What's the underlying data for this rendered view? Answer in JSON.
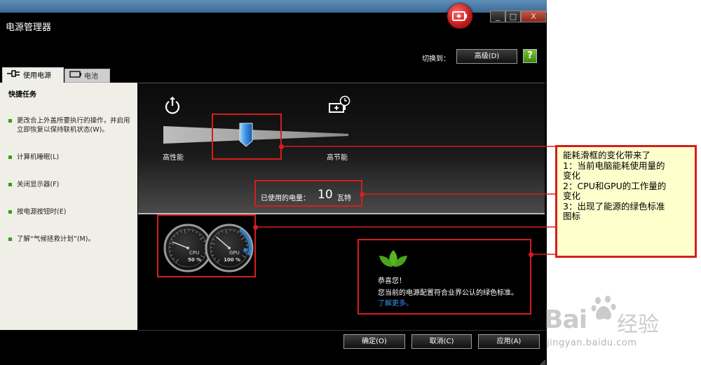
{
  "window": {
    "title": "电源管理器"
  },
  "title_controls": {
    "minimize": "_",
    "maximize": "□",
    "close": "X"
  },
  "header": {
    "switch_label": "切换到：",
    "advanced_button": "高级(D)",
    "help_glyph": "?"
  },
  "tabs": [
    {
      "label": "使用电源"
    },
    {
      "label": "电池"
    }
  ],
  "left_panel": {
    "title": "快捷任务",
    "items": [
      {
        "label": "更改合上外盖所要执行的操作，并启用立即恢复以保持联机状态(W)。"
      },
      {
        "label": "计算机睡眠(L)"
      },
      {
        "label": "关闭显示器(F)"
      },
      {
        "label": "按电源按钮时(E)"
      },
      {
        "label": "了解“气候拯救计划”(M)。"
      }
    ]
  },
  "slider": {
    "left_label": "高性能",
    "right_label": "高节能"
  },
  "power": {
    "label": "已使用的电量：",
    "value": "10",
    "unit": "瓦特"
  },
  "gauges": {
    "cpu": {
      "label": "CPU",
      "value": "50 %",
      "level": 0.5
    },
    "gpu": {
      "label": "GPU",
      "value": "100 %",
      "level": 1.0
    }
  },
  "green_info": {
    "title": "恭喜您！",
    "message": "您当前的电源配置符合业界公认的绿色标准。",
    "link": "了解更多。"
  },
  "footer": {
    "ok": "确定(O)",
    "cancel": "取消(C)",
    "apply": "应用(A)"
  },
  "annotation": {
    "lines": [
      "能耗滑框的变化带来了",
      "1：当前电脑能耗使用量的",
      "变化",
      "2：CPU和GPU的工作量的",
      "变化",
      "3：出现了能源的绿色标准",
      "图标"
    ]
  },
  "watermark": {
    "logo": "Bai",
    "logo_cn": "经验",
    "url": "jingyan.baidu.com"
  },
  "colors": {
    "accent_red": "#d41e1e",
    "leaf_green": "#5ab526",
    "link_blue": "#3c8de8",
    "note_bg": "#ffffcc"
  }
}
